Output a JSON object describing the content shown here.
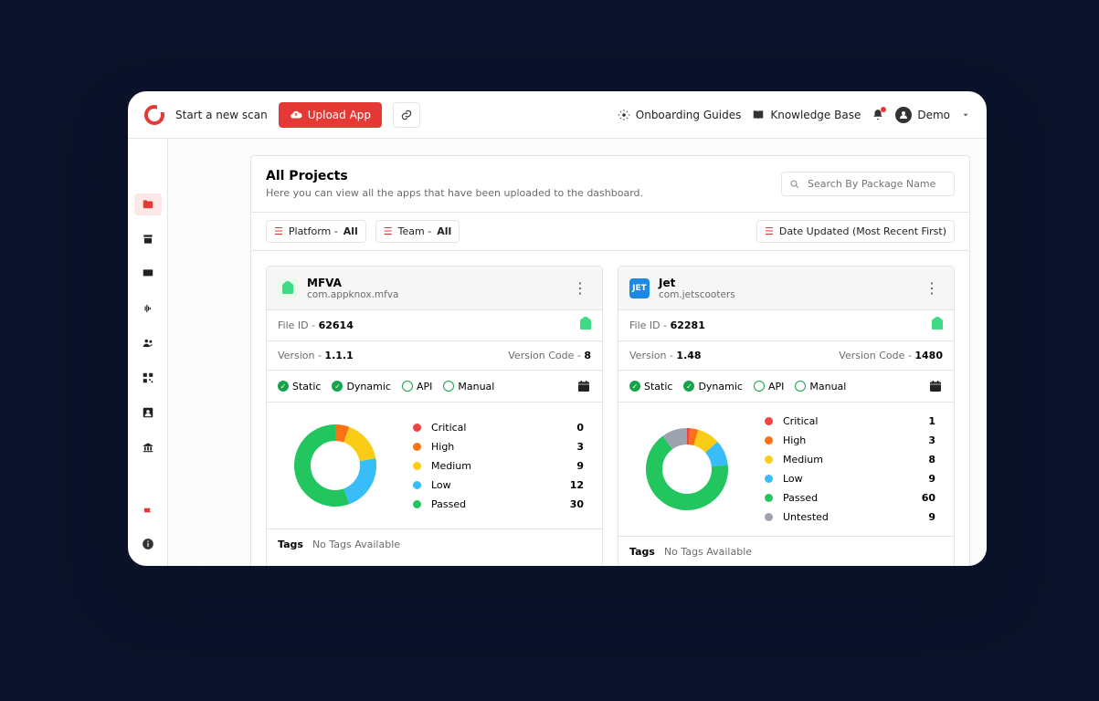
{
  "topbar": {
    "start_scan": "Start a new scan",
    "upload": "Upload App",
    "onboarding": "Onboarding Guides",
    "kb": "Knowledge Base",
    "user": "Demo"
  },
  "header": {
    "title": "All Projects",
    "subtitle": "Here you can view all the apps that have been uploaded to the dashboard.",
    "search_placeholder": "Search By Package Name"
  },
  "filters": {
    "platform_label": "Platform - ",
    "platform_value": "All",
    "team_label": "Team - ",
    "team_value": "All",
    "sort": "Date Updated (Most Recent First)"
  },
  "text": {
    "file_id": "File ID - ",
    "version": "Version - ",
    "version_code": "Version Code - ",
    "tags": "Tags",
    "no_tags": "No Tags Available",
    "scan_static": "Static",
    "scan_dynamic": "Dynamic",
    "scan_api": "API",
    "scan_manual": "Manual"
  },
  "legend": {
    "critical": "Critical",
    "high": "High",
    "medium": "Medium",
    "low": "Low",
    "passed": "Passed",
    "untested": "Untested"
  },
  "colors": {
    "critical": "#ef4444",
    "high": "#f97316",
    "medium": "#facc15",
    "low": "#38bdf8",
    "passed": "#22c55e",
    "untested": "#9ca3af"
  },
  "projects": [
    {
      "name": "MFVA",
      "pkg": "com.appknox.mfva",
      "icon": "android",
      "file_id": "62614",
      "version": "1.1.1",
      "version_code": "8",
      "scans": {
        "static": true,
        "dynamic": true,
        "api": false,
        "manual": false
      },
      "counts": {
        "critical": 0,
        "high": 3,
        "medium": 9,
        "low": 12,
        "passed": 30
      }
    },
    {
      "name": "Jet",
      "pkg": "com.jetscooters",
      "icon": "jet",
      "file_id": "62281",
      "version": "1.48",
      "version_code": "1480",
      "scans": {
        "static": true,
        "dynamic": true,
        "api": false,
        "manual": false
      },
      "counts": {
        "critical": 1,
        "high": 3,
        "medium": 8,
        "low": 9,
        "passed": 60,
        "untested": 9
      }
    }
  ],
  "chart_data": [
    {
      "type": "pie",
      "title": "MFVA severity distribution",
      "categories": [
        "Critical",
        "High",
        "Medium",
        "Low",
        "Passed"
      ],
      "values": [
        0,
        3,
        9,
        12,
        30
      ]
    },
    {
      "type": "pie",
      "title": "Jet severity distribution",
      "categories": [
        "Critical",
        "High",
        "Medium",
        "Low",
        "Passed",
        "Untested"
      ],
      "values": [
        1,
        3,
        8,
        9,
        60,
        9
      ]
    }
  ]
}
